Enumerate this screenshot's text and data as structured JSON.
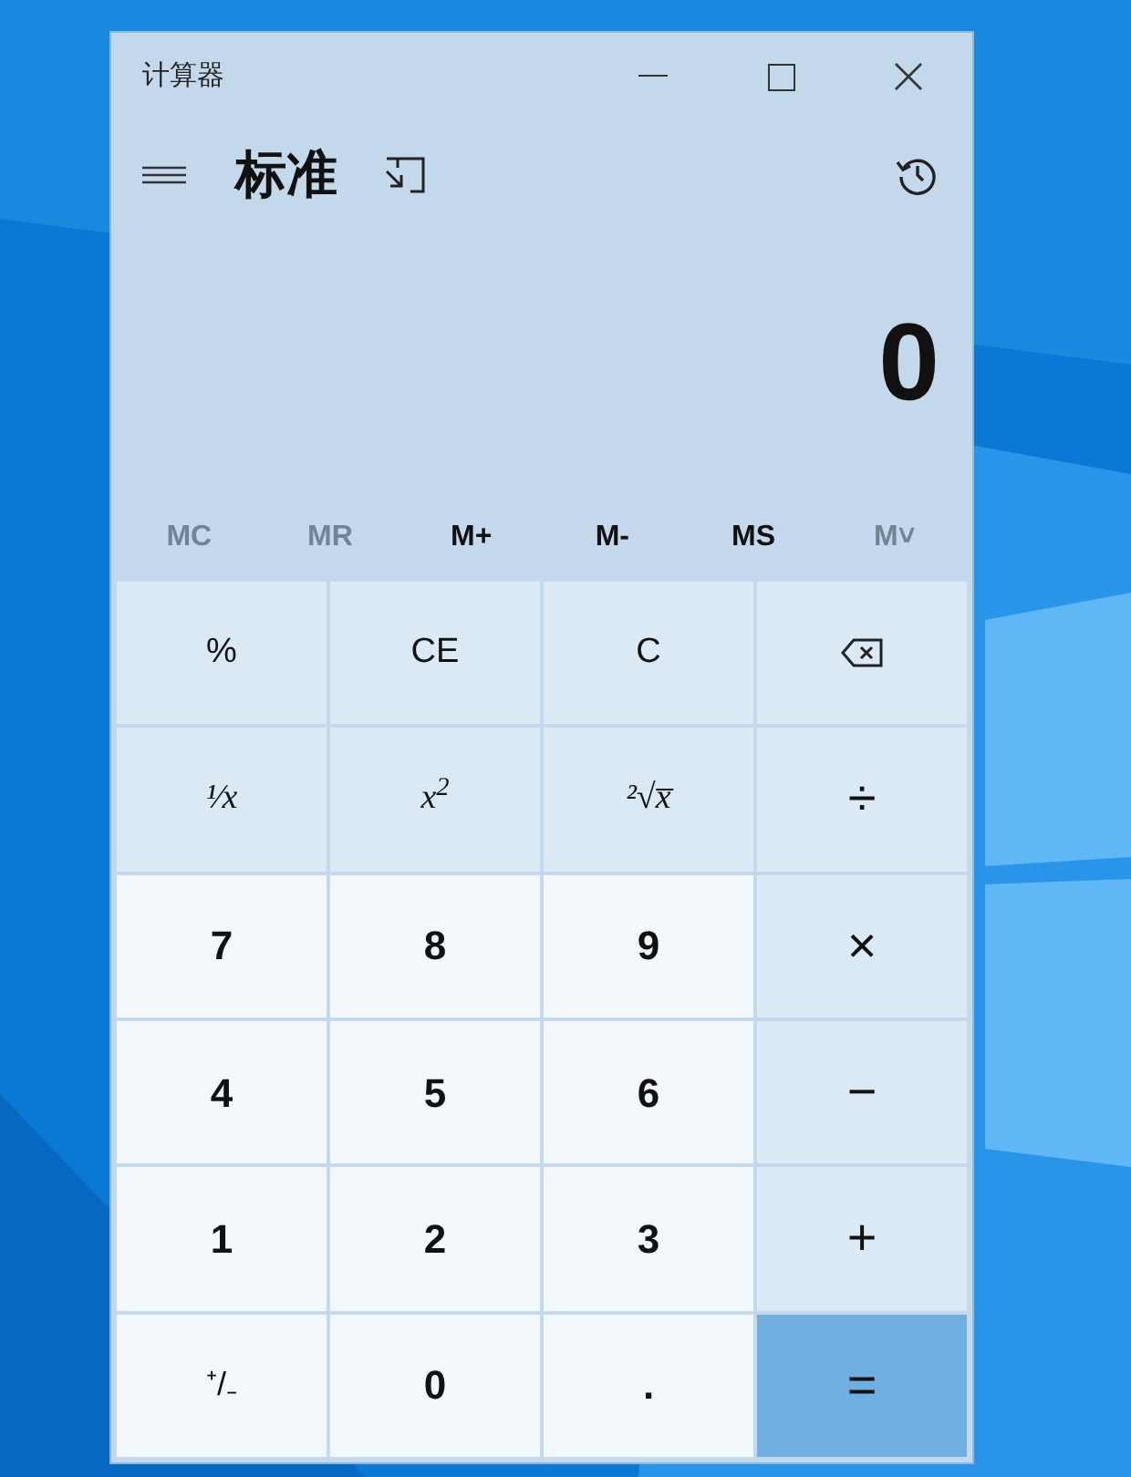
{
  "window": {
    "title": "计算器"
  },
  "header": {
    "mode": "标准"
  },
  "display": {
    "value": "0"
  },
  "memory": [
    {
      "label": "MC",
      "disabled": true
    },
    {
      "label": "MR",
      "disabled": true
    },
    {
      "label": "M+",
      "disabled": false
    },
    {
      "label": "M-",
      "disabled": false
    },
    {
      "label": "MS",
      "disabled": false
    },
    {
      "label": "M˅",
      "disabled": true
    }
  ],
  "keys": [
    {
      "kind": "function",
      "label": "%"
    },
    {
      "kind": "function",
      "label": "CE"
    },
    {
      "kind": "function",
      "label": "C"
    },
    {
      "kind": "backspace"
    },
    {
      "kind": "math",
      "label": "¹⁄x"
    },
    {
      "kind": "math",
      "label": "x$^{2}$"
    },
    {
      "kind": "math",
      "label": "²√x̅"
    },
    {
      "kind": "operator",
      "label": "÷"
    },
    {
      "kind": "digit",
      "label": "7"
    },
    {
      "kind": "digit",
      "label": "8"
    },
    {
      "kind": "digit",
      "label": "9"
    },
    {
      "kind": "operator",
      "label": "×"
    },
    {
      "kind": "digit",
      "label": "4"
    },
    {
      "kind": "digit",
      "label": "5"
    },
    {
      "kind": "digit",
      "label": "6"
    },
    {
      "kind": "operator",
      "label": "−"
    },
    {
      "kind": "digit",
      "label": "1"
    },
    {
      "kind": "digit",
      "label": "2"
    },
    {
      "kind": "digit",
      "label": "3"
    },
    {
      "kind": "operator",
      "label": "+"
    },
    {
      "kind": "sign",
      "label": "⁺/₋"
    },
    {
      "kind": "digit",
      "label": "0"
    },
    {
      "kind": "digit",
      "label": "."
    },
    {
      "kind": "equals",
      "label": "="
    }
  ]
}
